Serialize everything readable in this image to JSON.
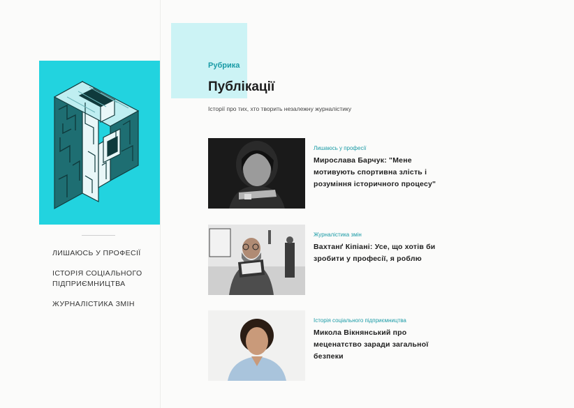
{
  "sidebar": {
    "logo_icon": "maze-letter-p-icon",
    "logo_color": "#22d3df",
    "nav": [
      {
        "label": "ЛИШАЮСЬ У ПРОФЕСІЇ"
      },
      {
        "label": "ІСТОРІЯ СОЦІАЛЬНОГО ПІДПРИЄМНИЦТВА"
      },
      {
        "label": "ЖУРНАЛІСТИКА ЗМІН"
      }
    ]
  },
  "header": {
    "kicker": "Рубрика",
    "title": "Публікації",
    "subtitle": "Історії про тих, хто творить незалежну журналістику"
  },
  "articles": [
    {
      "category": "Лишаюсь у професії",
      "title": "Мирослава Барчук: \"Мене мотивують спортивна злість і розуміння історичного процесу\""
    },
    {
      "category": "Журналістика змін",
      "title": "Вахтанґ Кіпіані: Усе, що хотів би зробити у професії, я роблю"
    },
    {
      "category": "Історія соціального підприємництва",
      "title": "Микола Вікнянський про меценатство заради загальної безпеки"
    }
  ],
  "colors": {
    "accent": "#1a9ba6",
    "accent_light": "#ccf3f5",
    "logo_bg": "#22d3df"
  }
}
